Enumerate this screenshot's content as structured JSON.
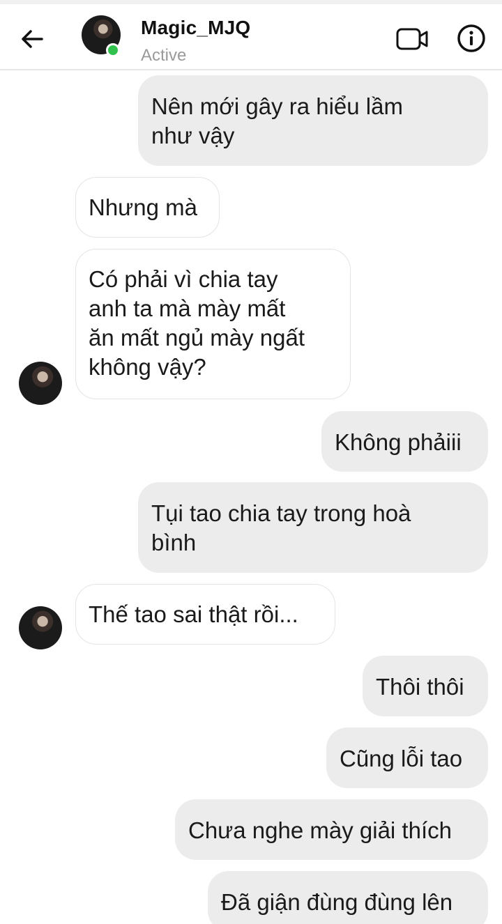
{
  "header": {
    "contact_name": "Magic_MJQ",
    "status": "Active",
    "icons": [
      "back-arrow-icon",
      "video-call-icon",
      "info-icon"
    ],
    "online_color": "#31c24d"
  },
  "messages": [
    {
      "side": "right",
      "text": "Nên mới gây ra hiểu lầm\nnhư vậy"
    },
    {
      "side": "left",
      "text": "Nhưng mà"
    },
    {
      "side": "left",
      "text": "Có phải vì chia tay\nanh ta mà mày mất\năn mất ngủ mày ngất\nkhông vậy?"
    },
    {
      "side": "right",
      "text": "Không phảiii"
    },
    {
      "side": "right",
      "text": "Tụi tao chia tay trong hoà\nbình"
    },
    {
      "side": "left",
      "text": "Thế tao sai thật rồi..."
    },
    {
      "side": "right",
      "text": "Thôi thôi"
    },
    {
      "side": "right",
      "text": "Cũng lỗi tao"
    },
    {
      "side": "right",
      "text": "Chưa nghe mày giải thích"
    },
    {
      "side": "right",
      "text": "Đã giận đùng đùng lên"
    }
  ],
  "colors": {
    "outgoing_bubble": "#ececec",
    "incoming_bubble": "#ffffff"
  }
}
